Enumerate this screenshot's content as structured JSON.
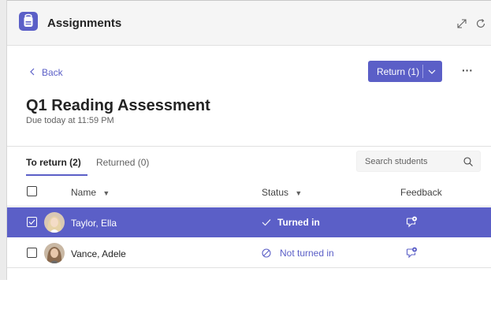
{
  "app": {
    "title": "Assignments",
    "accent": "#5b5fc7"
  },
  "nav": {
    "back_label": "Back"
  },
  "actions": {
    "return_label": "Return (1)",
    "more_label": "···"
  },
  "assignment": {
    "title": "Q1 Reading Assessment",
    "due": "Due today at 11:59 PM"
  },
  "tabs": [
    {
      "label": "To return (2)",
      "active": true
    },
    {
      "label": "Returned (0)",
      "active": false
    }
  ],
  "search": {
    "placeholder": "Search students"
  },
  "table": {
    "columns": {
      "name": "Name",
      "status": "Status",
      "feedback": "Feedback"
    },
    "rows": [
      {
        "name": "Taylor, Ella",
        "status": "Turned in",
        "status_icon": "check-icon",
        "selected": true
      },
      {
        "name": "Vance, Adele",
        "status": "Not turned in",
        "status_icon": "prohibited-icon",
        "selected": false
      }
    ]
  }
}
